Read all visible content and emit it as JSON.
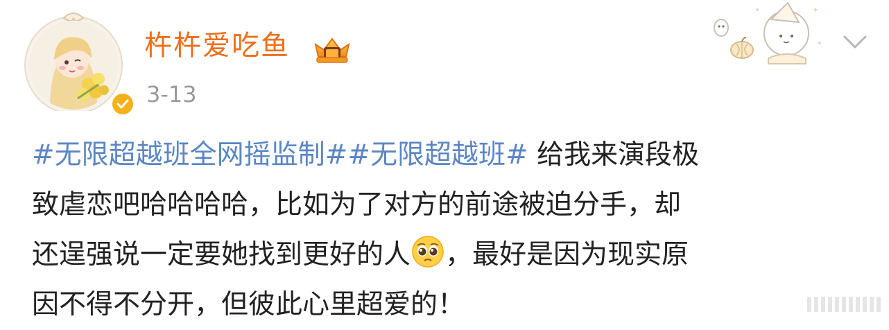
{
  "header": {
    "username": "杵杵爱吃鱼",
    "timestamp": "3-13",
    "badge_icon": "crown-badge-icon",
    "verified_icon": "verified-check-icon",
    "expand_icon": "chevron-down-icon"
  },
  "post": {
    "line1": {
      "tag1": "#无限超越班全网摇监制#",
      "tag2": "#无限超越班#",
      "text": " 给我来演段极"
    },
    "line2": "致虐恋吧哈哈哈哈，比如为了对方的前途被迫分手，却",
    "line3": {
      "before_emoji": "还逞强说一定要她找到更好的人",
      "emoji": "pleading-face-emoji",
      "after_emoji": "，最好是因为现实原"
    },
    "line4": "因不得不分开，但彼此心里超爱的！"
  },
  "colors": {
    "username": "#f06e1c",
    "hashtag": "#5b86c4",
    "text": "#222222",
    "timestamp": "#999999",
    "verified": "#f3b21a"
  }
}
